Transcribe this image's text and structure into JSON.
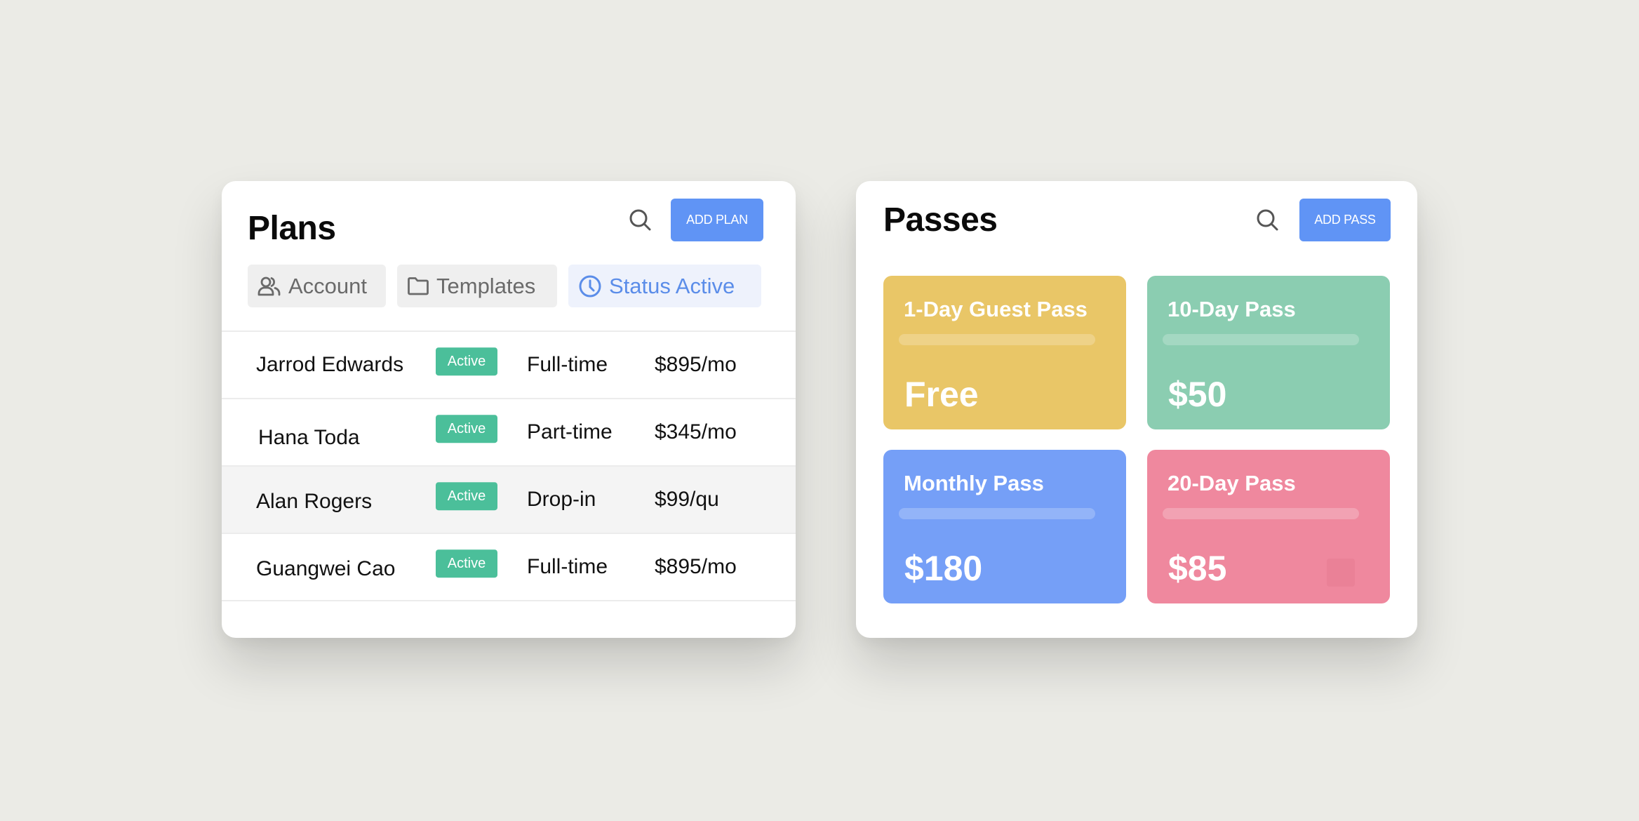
{
  "plans": {
    "title": "Plans",
    "search_icon": "search-icon",
    "add_label": "ADD PLAN",
    "filters": [
      {
        "label": "Account",
        "icon": "users-icon",
        "active": false
      },
      {
        "label": "Templates",
        "icon": "folder-icon",
        "active": false
      },
      {
        "label": "Status Active",
        "icon": "clock-icon",
        "active": true
      }
    ],
    "rows": [
      {
        "name": "Jarrod Edwards",
        "status": "Active",
        "type": "Full-time",
        "price": "$895/mo"
      },
      {
        "name": "Hana Toda",
        "status": "Active",
        "type": "Part-time",
        "price": "$345/mo"
      },
      {
        "name": "Alan Rogers",
        "status": "Active",
        "type": "Drop-in",
        "price": "$99/qu"
      },
      {
        "name": "Guangwei Cao",
        "status": "Active",
        "type": "Full-time",
        "price": "$895/mo"
      }
    ]
  },
  "passes": {
    "title": "Passes",
    "search_icon": "search-icon",
    "add_label": "ADD PASS",
    "items": [
      {
        "name": "1-Day Guest Pass",
        "price": "Free",
        "color": "#e9c667"
      },
      {
        "name": "10-Day Pass",
        "price": "$50",
        "color": "#8bcdb1"
      },
      {
        "name": "Monthly Pass",
        "price": "$180",
        "color": "#759ff7"
      },
      {
        "name": "20-Day Pass",
        "price": "$85",
        "color": "#ef889e"
      }
    ]
  },
  "colors": {
    "accent": "#6094f5",
    "badge": "#4bbf9a",
    "active_filter_text": "#5b8de9",
    "background": "#ebebe6"
  }
}
